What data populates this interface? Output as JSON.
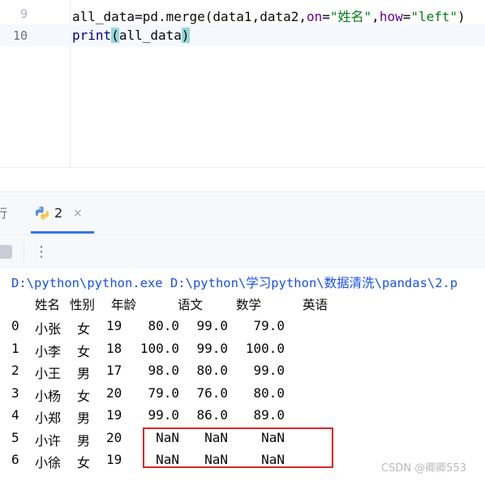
{
  "editor": {
    "lines": [
      {
        "number": "9",
        "parts": {
          "a": "all_data=pd.merge(data1,data2,",
          "b": "on",
          "c": "=",
          "d": "\"姓名\"",
          "e": ",",
          "f": "how",
          "g": "=",
          "h": "\"left\"",
          "i": ")"
        }
      },
      {
        "number": "10",
        "parts": {
          "a": "print",
          "b": "(",
          "c": "all_data",
          "d": ")"
        }
      }
    ]
  },
  "run_window": {
    "tab_partial": "行",
    "tab": {
      "label": "2",
      "close": "×",
      "icon": "python-icon"
    },
    "toolbar": {
      "stop_icon": "stop-icon",
      "more_glyph": "⋮"
    }
  },
  "console": {
    "command": "D:\\python\\python.exe D:\\python\\学习python\\数据清洗\\pandas\\2.p",
    "headers": [
      "姓名",
      "性别",
      "年龄",
      "语文",
      "数学",
      "英语"
    ],
    "rows": [
      {
        "index": "0",
        "name": "小张",
        "gender": "女",
        "age": "19",
        "chinese": "80.0",
        "math": "99.0",
        "english": "79.0"
      },
      {
        "index": "1",
        "name": "小李",
        "gender": "女",
        "age": "18",
        "chinese": "100.0",
        "math": "99.0",
        "english": "100.0"
      },
      {
        "index": "2",
        "name": "小王",
        "gender": "男",
        "age": "17",
        "chinese": "98.0",
        "math": "80.0",
        "english": "99.0"
      },
      {
        "index": "3",
        "name": "小杨",
        "gender": "女",
        "age": "20",
        "chinese": "79.0",
        "math": "76.0",
        "english": "80.0"
      },
      {
        "index": "4",
        "name": "小郑",
        "gender": "男",
        "age": "19",
        "chinese": "99.0",
        "math": "86.0",
        "english": "89.0"
      },
      {
        "index": "5",
        "name": "小许",
        "gender": "男",
        "age": "20",
        "chinese": "NaN",
        "math": "NaN",
        "english": "NaN"
      },
      {
        "index": "6",
        "name": "小徐",
        "gender": "女",
        "age": "19",
        "chinese": "NaN",
        "math": "NaN",
        "english": "NaN"
      }
    ]
  },
  "watermark": "CSDN @卿卿553",
  "colors": {
    "keyword_arg": "#660099",
    "string": "#067d17",
    "builtin": "#000080",
    "command": "#1750eb",
    "highlight_box": "#d9252a",
    "tab_underline": "#3574f0"
  }
}
